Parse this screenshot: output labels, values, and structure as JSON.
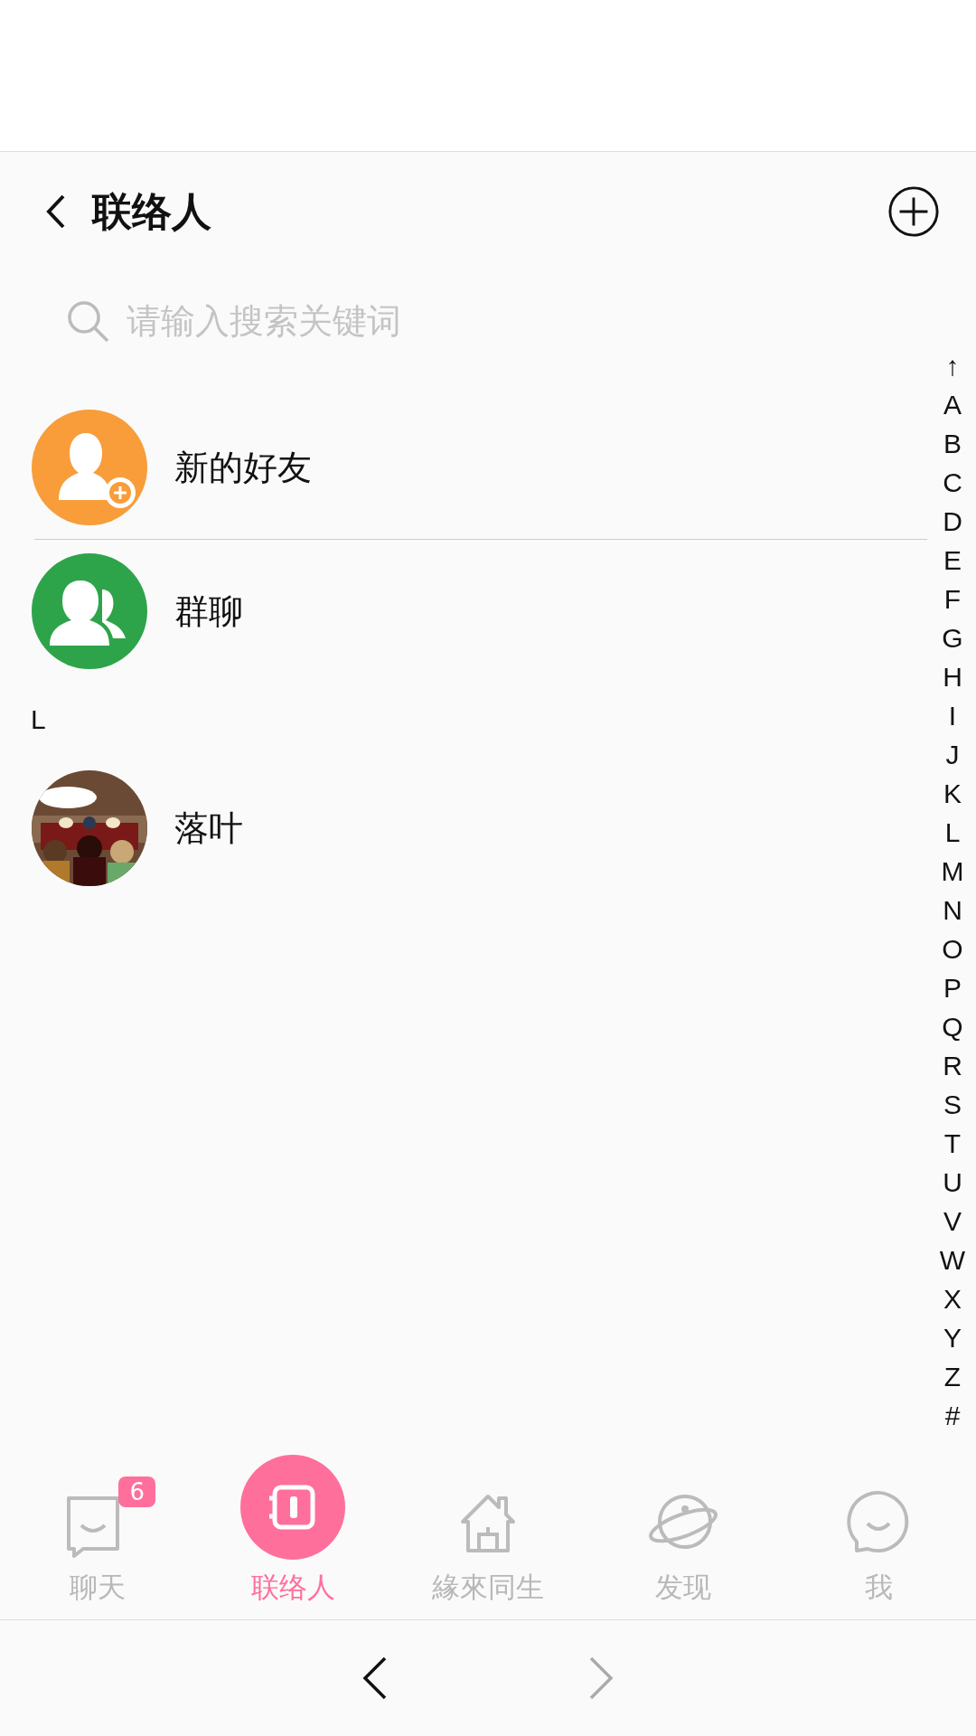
{
  "header": {
    "title": "联络人"
  },
  "search": {
    "placeholder": "请输入搜索关键词"
  },
  "list": [
    {
      "kind": "new_friend",
      "name": "新的好友"
    },
    {
      "kind": "group",
      "name": "群聊"
    },
    {
      "kind": "section",
      "label": "L"
    },
    {
      "kind": "contact",
      "name": "落叶"
    }
  ],
  "index_bar": [
    "↑",
    "A",
    "B",
    "C",
    "D",
    "E",
    "F",
    "G",
    "H",
    "I",
    "J",
    "K",
    "L",
    "M",
    "N",
    "O",
    "P",
    "Q",
    "R",
    "S",
    "T",
    "U",
    "V",
    "W",
    "X",
    "Y",
    "Z",
    "#"
  ],
  "tabs": [
    {
      "kind": "chat",
      "label": "聊天",
      "badge": "6",
      "selected": false
    },
    {
      "kind": "contacts",
      "label": "联络人",
      "selected": true
    },
    {
      "kind": "home",
      "label": "緣來同生",
      "selected": false
    },
    {
      "kind": "discover",
      "label": "发现",
      "selected": false
    },
    {
      "kind": "me",
      "label": "我",
      "selected": false
    }
  ],
  "browser_nav": {
    "back_disabled": false,
    "forward_disabled": true
  }
}
